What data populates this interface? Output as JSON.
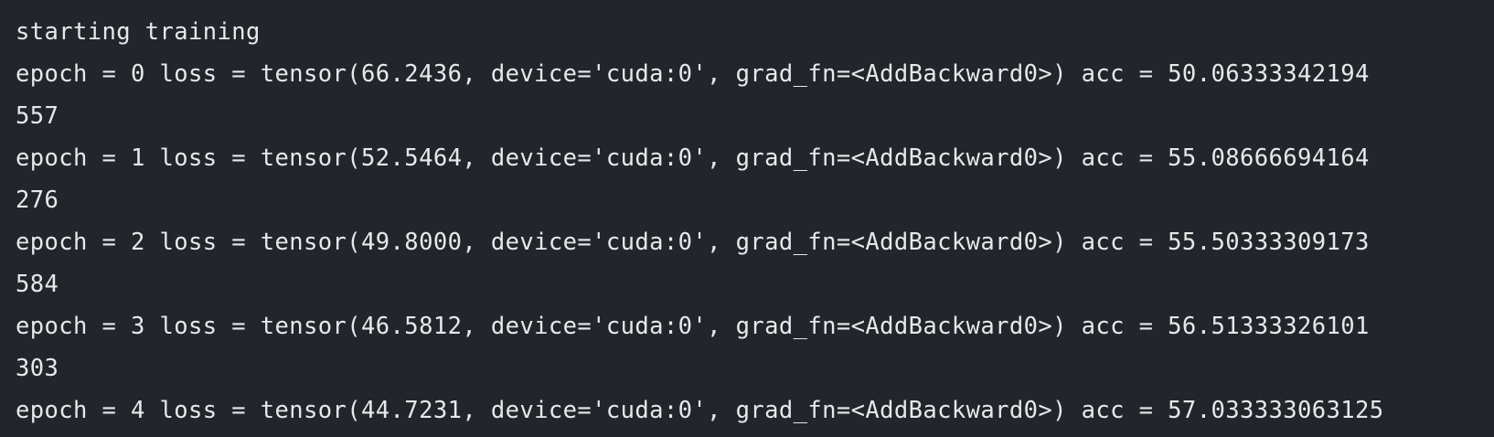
{
  "console": {
    "lines": [
      "starting training",
      "epoch = 0 loss = tensor(66.2436, device='cuda:0', grad_fn=<AddBackward0>) acc = 50.06333342194",
      "557",
      "epoch = 1 loss = tensor(52.5464, device='cuda:0', grad_fn=<AddBackward0>) acc = 55.08666694164",
      "276",
      "epoch = 2 loss = tensor(49.8000, device='cuda:0', grad_fn=<AddBackward0>) acc = 55.50333309173",
      "584",
      "epoch = 3 loss = tensor(46.5812, device='cuda:0', grad_fn=<AddBackward0>) acc = 56.51333326101",
      "303",
      "epoch = 4 loss = tensor(44.7231, device='cuda:0', grad_fn=<AddBackward0>) acc = 57.033333063125"
    ]
  },
  "colors": {
    "background": "#22252c",
    "text": "#e8e8e8"
  }
}
